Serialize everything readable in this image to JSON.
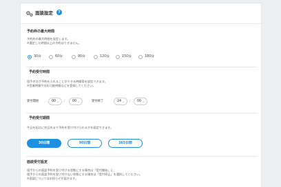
{
  "header": {
    "icon": "gear-icon",
    "title": "面談設定",
    "help_icon": "help-icon",
    "help_glyph": "?"
  },
  "max_reservations": {
    "title": "予約枠の最大時間",
    "desc_lines": [
      "予約枠の最大時間を設定します。",
      "※選定した時間以上の予約はできません。"
    ],
    "options": [
      "30分",
      "60分",
      "90分",
      "120分",
      "150分",
      "180分"
    ],
    "selected": "30分"
  },
  "reception_time": {
    "title": "予約受付時間",
    "desc_lines": [
      "相手の方が予約を入れることができる時間帯を設定できます。",
      "※営業時間や対応可能時間などを登録してください。"
    ],
    "start_label": "受付開始",
    "start_hour": "00",
    "start_minute": "00",
    "end_label": "受付終了",
    "end_hour": "24",
    "end_minute": "00",
    "colon": ":",
    "chevron_glyph": "⌄"
  },
  "reception_period": {
    "title": "予約受付期間",
    "desc": "今日を起点に何日先まで予約を受け付けられるかを設定できます。",
    "options": [
      "30日間",
      "90日間",
      "365日間"
    ],
    "selected": "30日間"
  },
  "meeting_settings": {
    "title": "面談受付設定",
    "desc_lines": [
      "相手からの面談予約を受け付ける状態にする場合は「受付開始」に、",
      "相手からの面談予約を受け付けない状態にする場合は「受付停止」を選択してください。",
      "※面談についてはお知らせが届きます。"
    ]
  }
}
